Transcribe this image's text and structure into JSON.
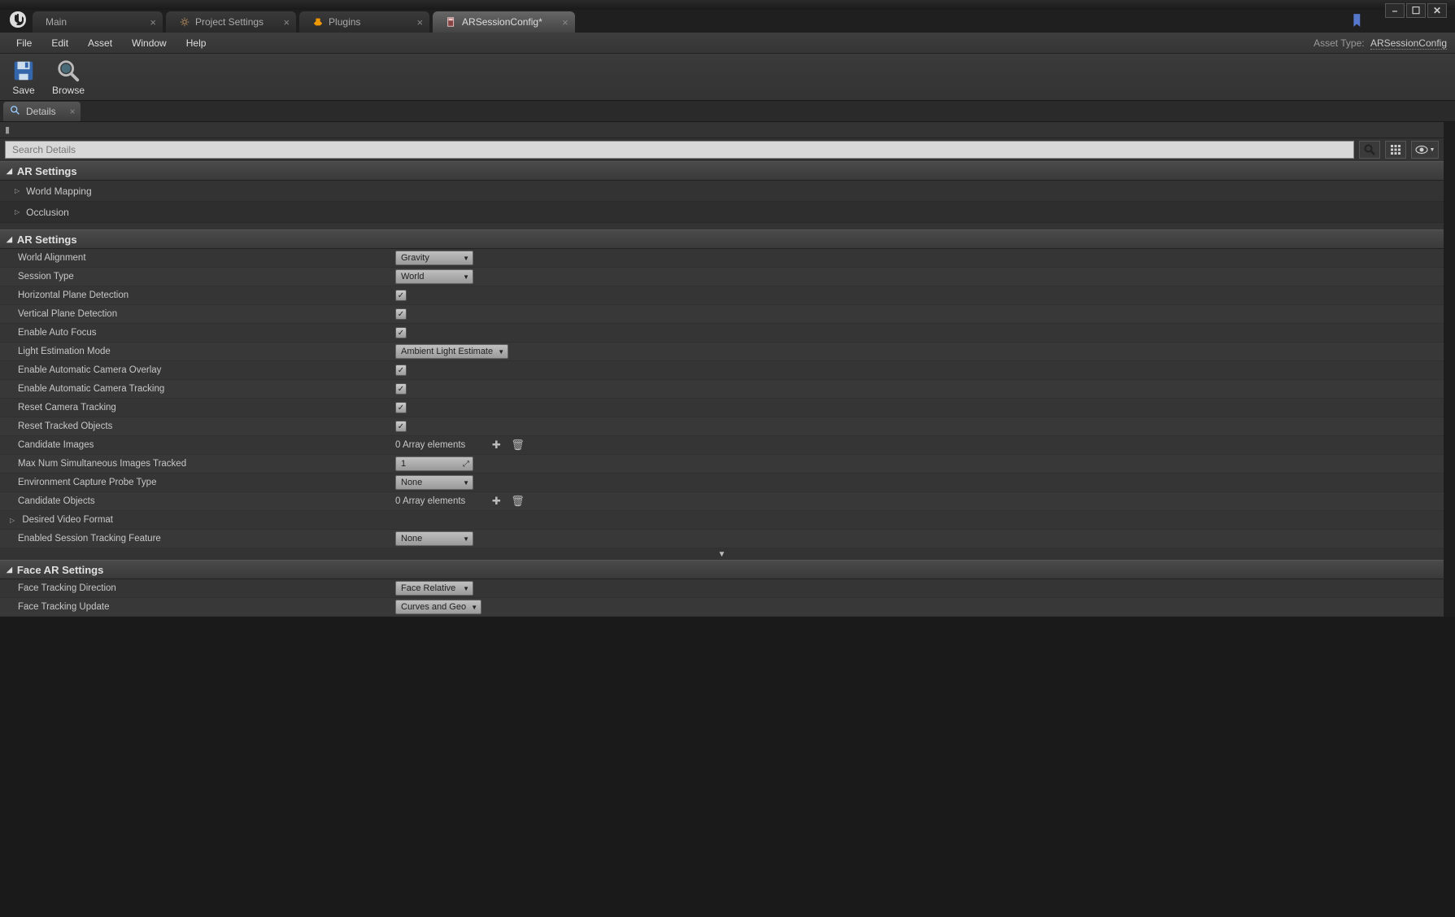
{
  "window": {
    "tabs": [
      {
        "label": "Main"
      },
      {
        "label": "Project Settings"
      },
      {
        "label": "Plugins"
      },
      {
        "label": "ARSessionConfig*"
      }
    ]
  },
  "menu": {
    "items": [
      "File",
      "Edit",
      "Asset",
      "Window",
      "Help"
    ],
    "asset_type_label": "Asset Type:",
    "asset_type_value": "ARSessionConfig"
  },
  "toolbar": {
    "save": "Save",
    "browse": "Browse"
  },
  "details_tab": "Details",
  "search": {
    "placeholder": "Search Details"
  },
  "sections": {
    "ar_settings_1": {
      "title": "AR Settings",
      "sub": [
        "World Mapping",
        "Occlusion"
      ]
    },
    "ar_settings_2": {
      "title": "AR Settings",
      "rows": {
        "world_alignment": {
          "label": "World Alignment",
          "value": "Gravity"
        },
        "session_type": {
          "label": "Session Type",
          "value": "World"
        },
        "horizontal_plane": {
          "label": "Horizontal Plane Detection",
          "checked": true
        },
        "vertical_plane": {
          "label": "Vertical Plane Detection",
          "checked": true
        },
        "auto_focus": {
          "label": "Enable Auto Focus",
          "checked": true
        },
        "light_est": {
          "label": "Light Estimation Mode",
          "value": "Ambient Light Estimate"
        },
        "cam_overlay": {
          "label": "Enable Automatic Camera Overlay",
          "checked": true
        },
        "cam_tracking": {
          "label": "Enable Automatic Camera Tracking",
          "checked": true
        },
        "reset_cam": {
          "label": "Reset Camera Tracking",
          "checked": true
        },
        "reset_obj": {
          "label": "Reset Tracked Objects",
          "checked": true
        },
        "cand_images": {
          "label": "Candidate Images",
          "array": "0 Array elements"
        },
        "max_num": {
          "label": "Max Num Simultaneous Images Tracked",
          "value": "1"
        },
        "env_probe": {
          "label": "Environment Capture Probe Type",
          "value": "None"
        },
        "cand_objects": {
          "label": "Candidate Objects",
          "array": "0 Array elements"
        },
        "video_fmt": {
          "label": "Desired Video Format"
        },
        "session_feature": {
          "label": "Enabled Session Tracking Feature",
          "value": "None"
        }
      }
    },
    "face_ar": {
      "title": "Face AR Settings",
      "rows": {
        "direction": {
          "label": "Face Tracking Direction",
          "value": "Face Relative"
        },
        "update": {
          "label": "Face Tracking Update",
          "value": "Curves and Geo"
        }
      }
    }
  }
}
